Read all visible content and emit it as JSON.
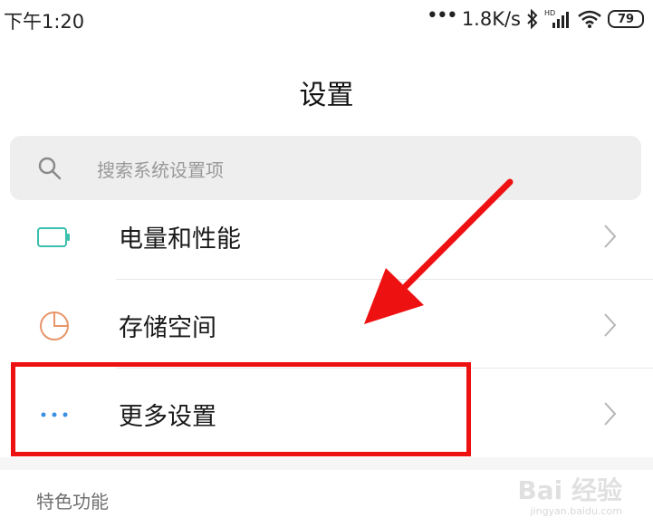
{
  "status_bar": {
    "time": "下午1:20",
    "dots": "•••",
    "net_speed": "1.8K/s",
    "bluetooth_icon": "bluetooth-icon",
    "signal_icon": "hd-signal-icon",
    "wifi_icon": "wifi-icon",
    "battery_level": "79"
  },
  "header": {
    "title": "设置"
  },
  "search": {
    "placeholder": "搜索系统设置项",
    "icon": "search-icon"
  },
  "settings_list": [
    {
      "label": "电量和性能",
      "icon": "battery-icon",
      "icon_color": "#3bbfae"
    },
    {
      "label": "存储空间",
      "icon": "pie-chart-icon",
      "icon_color": "#e8956a"
    },
    {
      "label": "更多设置",
      "icon": "more-dots-icon",
      "icon_color": "#3a8fe0"
    }
  ],
  "section": {
    "header": "特色功能"
  },
  "annotation": {
    "color": "#ee1111"
  },
  "watermark": {
    "logo": "Bai 经验",
    "site": "jingyan.baidu.com"
  }
}
